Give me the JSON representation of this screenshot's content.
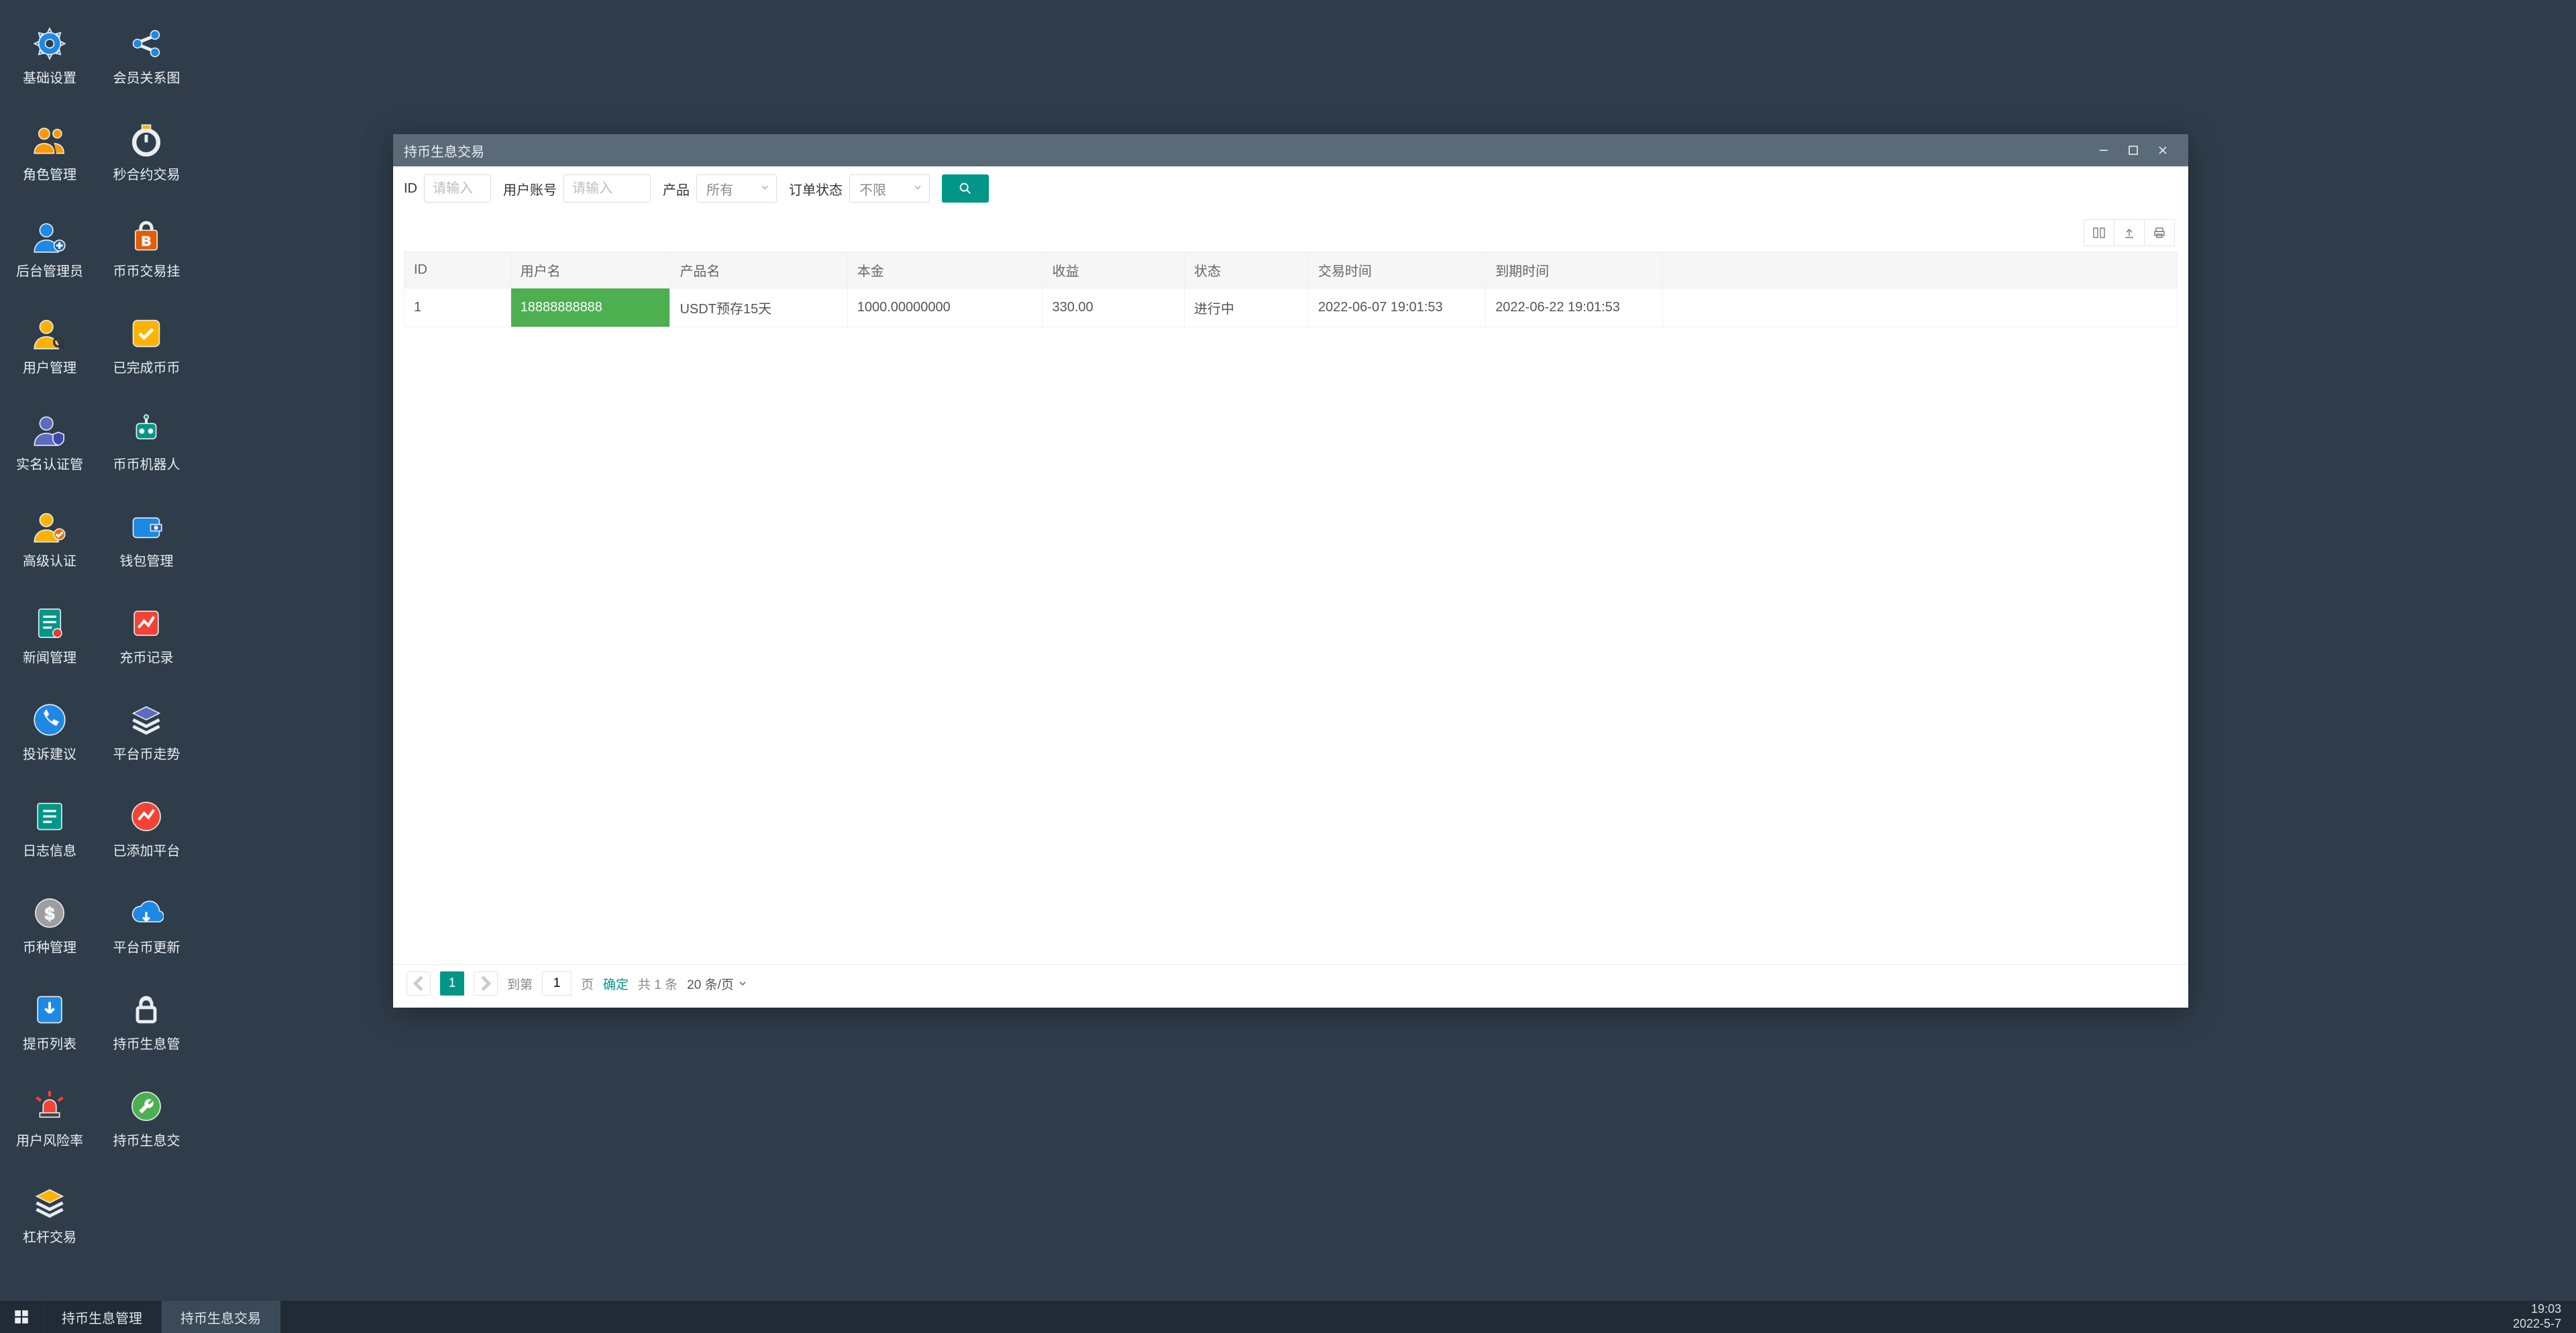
{
  "desktop_icons_col1": [
    {
      "label": "基础设置",
      "icon": "gear",
      "color": "c-blue"
    },
    {
      "label": "角色管理",
      "icon": "users",
      "color": "c-orange"
    },
    {
      "label": "后台管理员",
      "icon": "user-add",
      "color": "c-blue"
    },
    {
      "label": "用户管理",
      "icon": "user-search",
      "color": "c-amber"
    },
    {
      "label": "实名认证管",
      "icon": "user-shield",
      "color": "c-indigo"
    },
    {
      "label": "高级认证",
      "icon": "user-badge",
      "color": "c-amber"
    },
    {
      "label": "新闻管理",
      "icon": "doc",
      "color": "c-teal"
    },
    {
      "label": "投诉建议",
      "icon": "phone",
      "color": "c-blue"
    },
    {
      "label": "日志信息",
      "icon": "log",
      "color": "c-teal"
    },
    {
      "label": "币种管理",
      "icon": "coin",
      "color": "c-grey"
    },
    {
      "label": "提币列表",
      "icon": "download",
      "color": "c-blue"
    },
    {
      "label": "用户风险率",
      "icon": "siren",
      "color": "c-red"
    },
    {
      "label": "杠杆交易",
      "icon": "layers",
      "color": "c-amber"
    }
  ],
  "desktop_icons_col2": [
    {
      "label": "会员关系图",
      "icon": "share",
      "color": "c-blue"
    },
    {
      "label": "秒合约交易",
      "icon": "timer",
      "color": "c-amber"
    },
    {
      "label": "币币交易挂",
      "icon": "bag",
      "color": "c-darkorange"
    },
    {
      "label": "已完成币币",
      "icon": "check",
      "color": "c-amber"
    },
    {
      "label": "币币机器人",
      "icon": "robot",
      "color": "c-teal"
    },
    {
      "label": "钱包管理",
      "icon": "wallet",
      "color": "c-blue"
    },
    {
      "label": "充币记录",
      "icon": "chart",
      "color": "c-red"
    },
    {
      "label": "平台币走势",
      "icon": "layers",
      "color": "c-indigo"
    },
    {
      "label": "已添加平台",
      "icon": "chart-round",
      "color": "c-red"
    },
    {
      "label": "平台币更新",
      "icon": "cloud",
      "color": "c-blue"
    },
    {
      "label": "持币生息管",
      "icon": "lock",
      "color": "c-green"
    },
    {
      "label": "持币生息交",
      "icon": "wrench",
      "color": "c-green"
    }
  ],
  "taskbar": {
    "items": [
      {
        "label": "持币生息管理",
        "active": false
      },
      {
        "label": "持币生息交易",
        "active": true
      }
    ],
    "time": "19:03",
    "date": "2022-5-7"
  },
  "window": {
    "title": "持币生息交易",
    "filters": {
      "id_label": "ID",
      "id_placeholder": "请输入",
      "account_label": "用户账号",
      "account_placeholder": "请输入",
      "product_label": "产品",
      "product_value": "所有",
      "status_label": "订单状态",
      "status_value": "不限"
    },
    "tools_export": "export",
    "tools_print": "print",
    "table": {
      "headers": [
        "ID",
        "用户名",
        "产品名",
        "本金",
        "收益",
        "状态",
        "交易时间",
        "到期时间"
      ],
      "rows": [
        {
          "id": "1",
          "user": "18888888888",
          "product": "USDT预存15天",
          "principal": "1000.00000000",
          "profit": "330.00",
          "status": "进行中",
          "trade_time": "2022-06-07 19:01:53",
          "expire_time": "2022-06-22 19:01:53"
        }
      ]
    },
    "pager": {
      "current": "1",
      "goto_label": "到第",
      "goto_value": "1",
      "page_suffix": "页",
      "confirm": "确定",
      "total": "共 1 条",
      "pagesize": "20 条/页"
    }
  }
}
